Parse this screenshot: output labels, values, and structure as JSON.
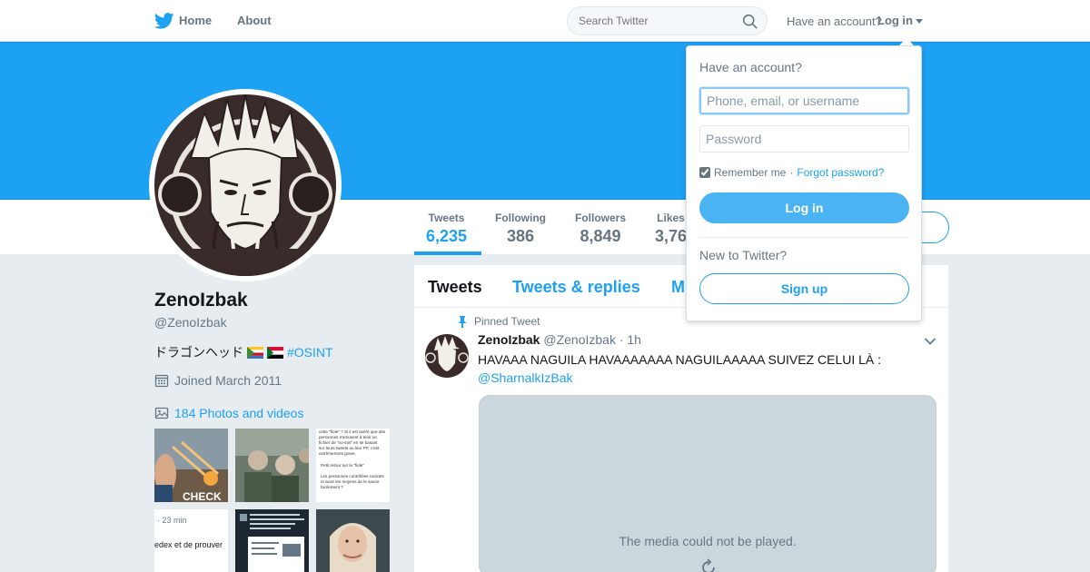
{
  "nav": {
    "home_label": "Home",
    "about_label": "About",
    "search_placeholder": "Search Twitter",
    "have_account": "Have an account?",
    "login_label": "Log in"
  },
  "profile": {
    "name": "ZenoIzbak",
    "handle": "@ZenoIzbak",
    "bio_text": "ドラゴンヘッド",
    "bio_hashtag": "#OSINT",
    "joined": "Joined March 2011",
    "photos_link": "184 Photos and videos"
  },
  "stats": [
    {
      "label": "Tweets",
      "value": "6,235"
    },
    {
      "label": "Following",
      "value": "386"
    },
    {
      "label": "Followers",
      "value": "8,849"
    },
    {
      "label": "Likes",
      "value": "3,76"
    }
  ],
  "thumbnails": {
    "t1_caption": "CHECK",
    "t3_line1": "cette \"fiole\" ? Si il est avéré que des",
    "t3_line2": "personnes s'amusent à tenir un",
    "t3_line3": "fichier de \"no-sos\" en se basant",
    "t3_line4": "sur leurs tweets ou leur PP, c'est",
    "t3_line5": "extrêmement grave.",
    "t3_line6": "Petit retour sur la \"fiole\"",
    "t3_line7": "Les personnes contrôlées racistes",
    "t3_line8": "et avoir les moyens de le savoir",
    "t3_line9": "facilement ?",
    "t4_time": "· 23 min",
    "t4_text": "edex et de prouver"
  },
  "timeline": {
    "tabs": [
      "Tweets",
      "Tweets & replies",
      "M"
    ],
    "pinned_label": "Pinned Tweet",
    "tweet": {
      "author": "ZenoIzbak",
      "handle": "@ZenoIzbak",
      "time": "· 1h",
      "text": "HAVAAA NAGUILA HAVAAAAAAA NAGUILAAAAA SUIVEZ CELUI LÀ :",
      "mention": "@SharnalkIzBak"
    },
    "media_message": "The media could not be played."
  },
  "login_dropdown": {
    "title": "Have an account?",
    "username_placeholder": "Phone, email, or username",
    "password_placeholder": "Password",
    "remember_label": "Remember me",
    "separator": "·",
    "forgot_label": "Forgot password?",
    "remember_checked": true,
    "login_button": "Log in",
    "new_to": "New to Twitter?",
    "signup_button": "Sign up"
  },
  "colors": {
    "brand": "#1da1f2",
    "banner": "#1da1f2",
    "background": "#e6ecf0",
    "login_button": "#4ab3f4"
  },
  "icons": [
    "twitter-bird-icon",
    "search-icon",
    "caret-down-icon",
    "calendar-icon",
    "image-icon",
    "pin-icon",
    "chevron-down-icon",
    "reload-icon"
  ]
}
